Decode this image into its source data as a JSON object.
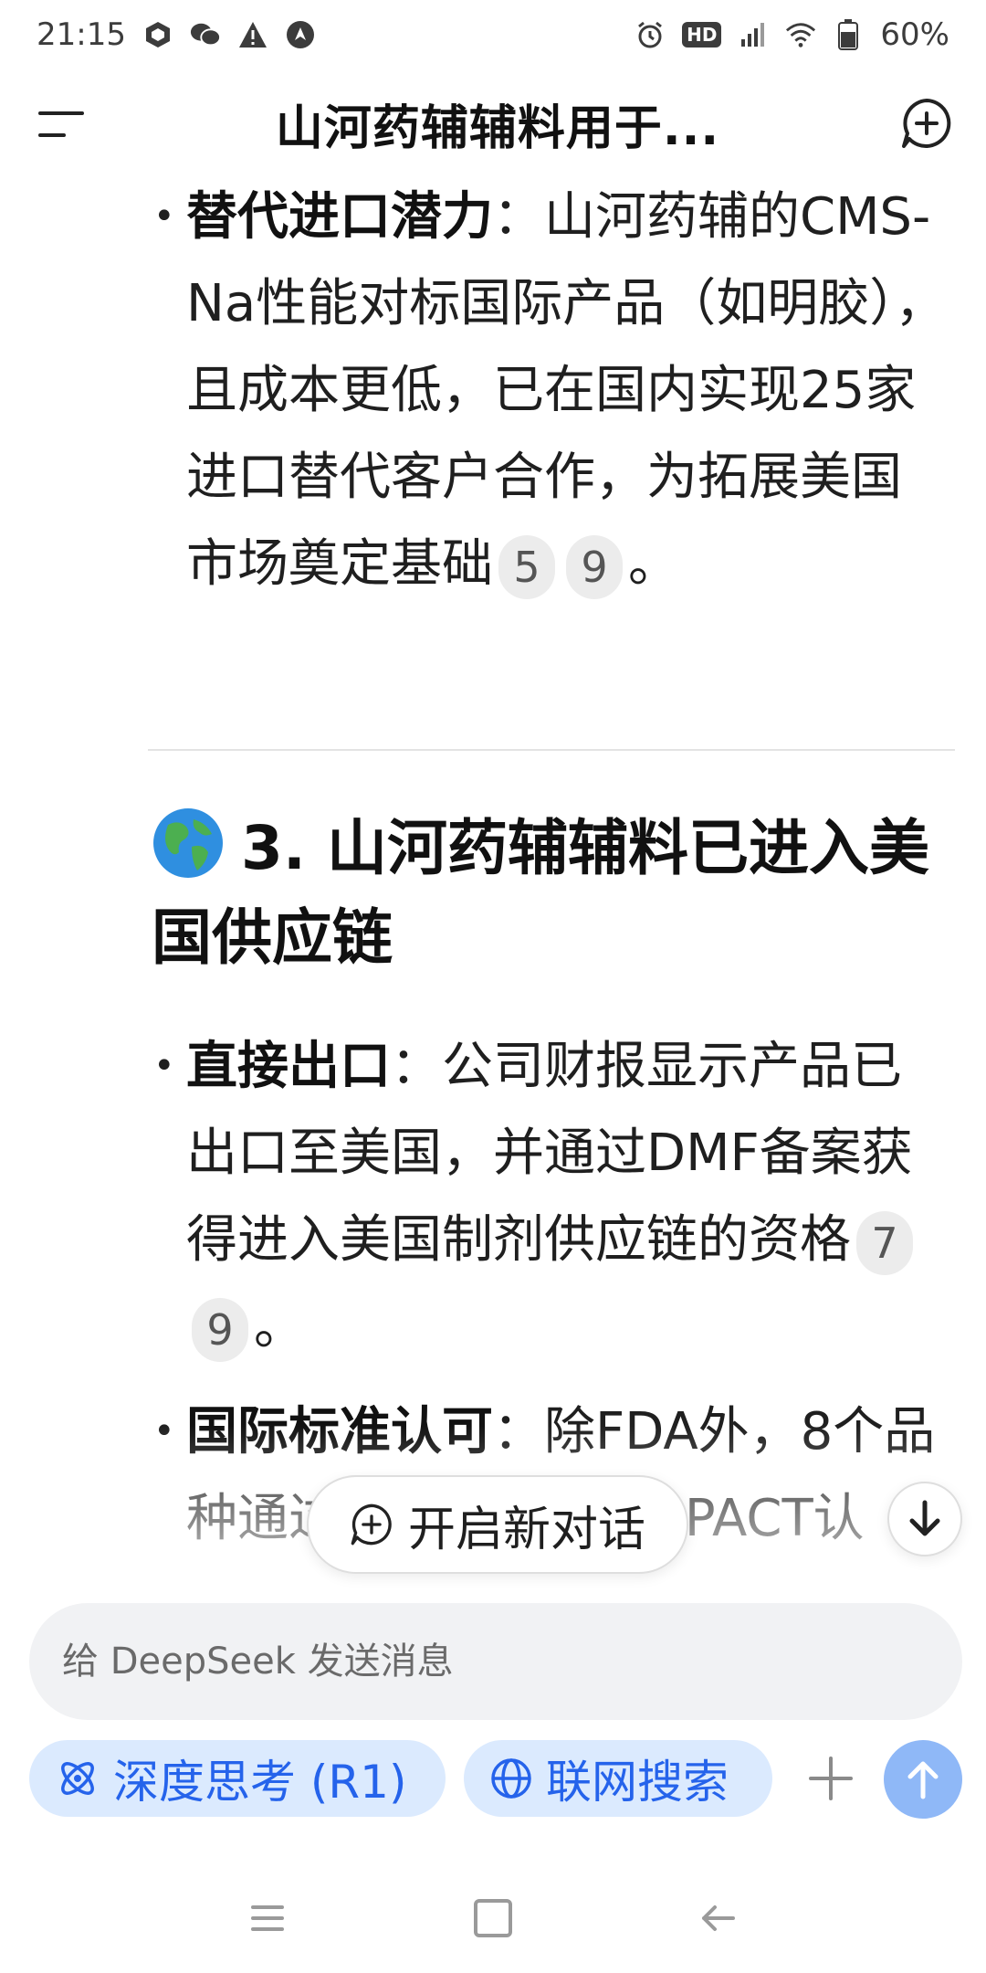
{
  "status_bar": {
    "time": "21:15",
    "hd": "HD",
    "battery": "60%"
  },
  "header": {
    "title": "山河药辅辅料用于..."
  },
  "content": {
    "bullet1": {
      "bold": "替代进口潜力",
      "sep": "：",
      "text": "山河药辅的CMS-Na性能对标国际产品（如明胶），且成本更低，已在国内实现25家进口替代客户合作，为拓展美国市场奠定基础",
      "cites": [
        "5",
        "9"
      ],
      "end": "。"
    },
    "section_heading": "3. 山河药辅辅料已进入美国供应链",
    "bullet2": {
      "bold": "直接出口",
      "sep": "：",
      "text": "公司财报显示产品已出口至美国，并通过DMF备案获得进入美国制剂供应链的资格",
      "cites": [
        "7",
        "9"
      ],
      "end": "。"
    },
    "bullet3": {
      "bold": "国际标准认可",
      "sep": "：",
      "text": "除FDA外，8个品种通过IPEC-PQG、CIPACT认"
    }
  },
  "floating": {
    "new_chat_label": "开启新对话"
  },
  "input": {
    "placeholder": "给 DeepSeek 发送消息"
  },
  "toolbar": {
    "deep_think_label": "深度思考 (R1)",
    "web_search_label": "联网搜索"
  },
  "colors": {
    "accent": "#2563eb",
    "chip_bg": "#dbeafe",
    "send_bg": "#8fb8f7"
  }
}
